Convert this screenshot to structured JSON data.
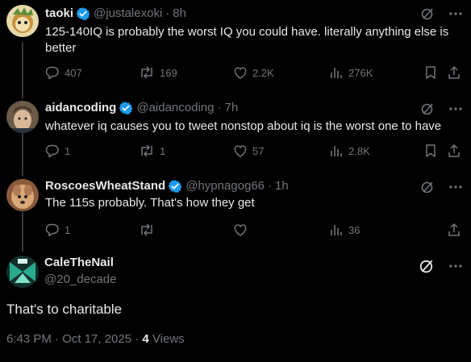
{
  "replies": [
    {
      "name": "taoki",
      "handle": "@justalexoki",
      "dot": "·",
      "time": "8h",
      "text": "125-140IQ is probably the worst IQ you could have. literally anything else is better",
      "replies_count": "407",
      "reposts_count": "169",
      "likes_count": "2.2K",
      "views_count": "276K"
    },
    {
      "name": "aidancoding",
      "handle": "@aidancoding",
      "dot": "·",
      "time": "7h",
      "text": "whatever iq causes you to tweet nonstop about iq is the worst one to have",
      "replies_count": "1",
      "reposts_count": "1",
      "likes_count": "57",
      "views_count": "2.8K"
    },
    {
      "name": "RoscoesWheatStand",
      "handle": "@hypnagog66",
      "dot": "·",
      "time": "1h",
      "text": "The 115s probably. That's how they get",
      "replies_count": "1",
      "reposts_count": "",
      "likes_count": "",
      "views_count": "36"
    }
  ],
  "main": {
    "name": "CaleTheNail",
    "handle": "@20_decade",
    "text": "That's to charitable",
    "timestamp": "6:43 PM · Oct 17, 2025 · ",
    "views_number": "4",
    "views_label": " Views"
  },
  "icons": {
    "verified": "verified-badge-icon",
    "grok": "grok-icon",
    "more": "more-icon",
    "reply": "reply-icon",
    "repost": "repost-icon",
    "like": "like-icon",
    "views": "views-icon",
    "bookmark": "bookmark-icon",
    "share": "share-icon"
  },
  "colors": {
    "background": "#000000",
    "primary_text": "#e7e9ea",
    "secondary_text": "#71767b",
    "verified_blue": "#1d9bf0",
    "thread_line": "#333639"
  }
}
